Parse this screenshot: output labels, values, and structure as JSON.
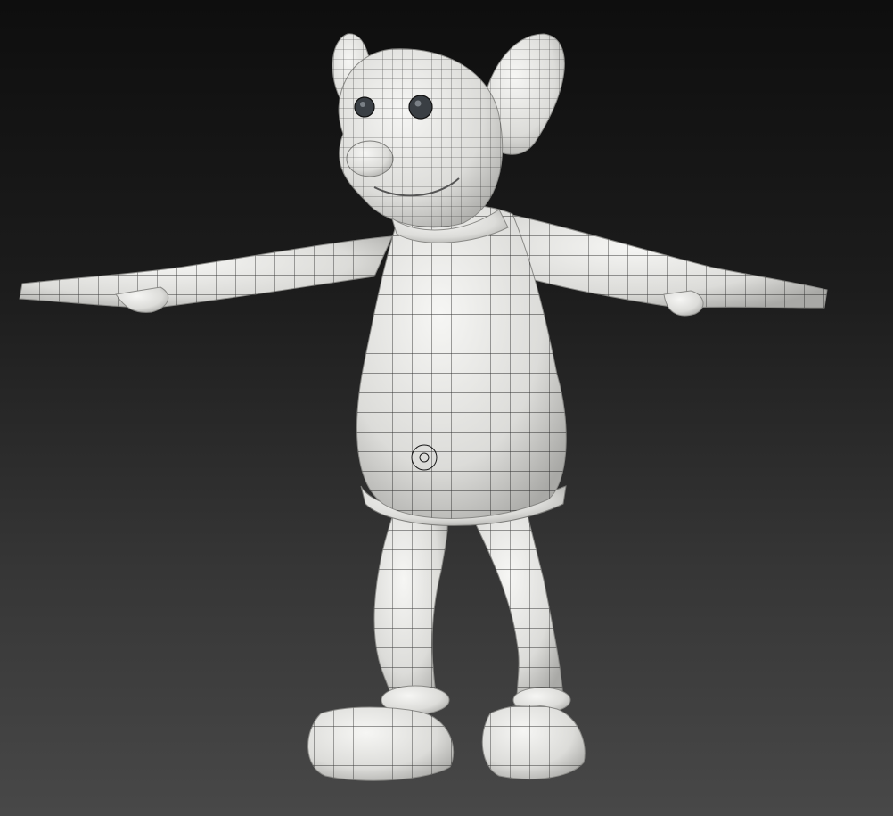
{
  "scene": {
    "background_top": "#0e0e0e",
    "background_bottom": "#484848",
    "skin_color": "#e8e8e6",
    "shade_color": "#b9b9b6",
    "wire_color": "#1a1a1a",
    "eye_color": "#3a3f44",
    "subject_icon": "cartoon-mouse-character-icon"
  }
}
